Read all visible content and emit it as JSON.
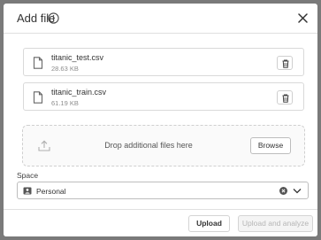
{
  "dialog": {
    "title": "Add file",
    "files": [
      {
        "name": "titanic_test.csv",
        "size": "28.63 KB"
      },
      {
        "name": "titanic_train.csv",
        "size": "61.19 KB"
      }
    ],
    "dropzone": {
      "text": "Drop additional files here",
      "browse_label": "Browse"
    },
    "space": {
      "label": "Space",
      "value": "Personal"
    },
    "footer": {
      "upload_label": "Upload",
      "upload_analyze_label": "Upload and analyze"
    }
  }
}
